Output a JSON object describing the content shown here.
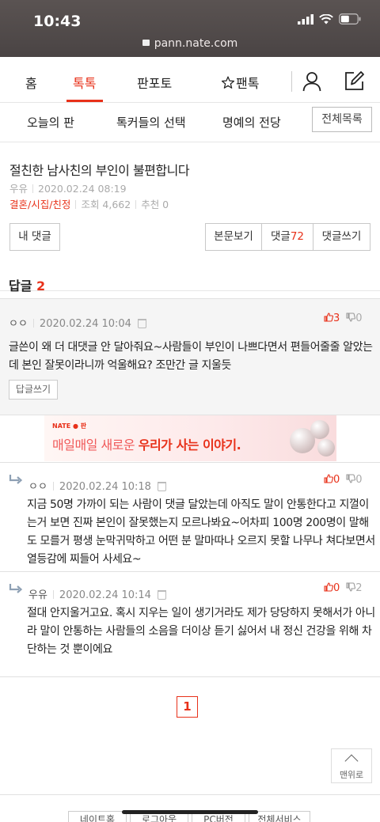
{
  "status_bar": {
    "time": "10:43"
  },
  "browser": {
    "url": "pann.nate.com"
  },
  "main_tabs": [
    {
      "label": "홈"
    },
    {
      "label": "톡톡"
    },
    {
      "label": "판포토"
    },
    {
      "label": "팬톡"
    }
  ],
  "sub_nav": {
    "items": [
      {
        "label": "오늘의 판"
      },
      {
        "label": "톡커들의 선택"
      },
      {
        "label": "명예의 전당"
      }
    ],
    "all_list": "전체목록"
  },
  "article": {
    "title": "절친한 남사친의 부인이 불편합니다",
    "author": "우유",
    "date": "2020.02.24 08:19",
    "category": "결혼/시집/친정",
    "views": "조회 4,662",
    "recommend": "추천 0"
  },
  "buttons": {
    "my_comments": "내 댓글",
    "view_article": "본문보기",
    "comments_label": "댓글",
    "comments_count": "72",
    "write_comment": "댓글쓰기"
  },
  "replies_header": {
    "label": "답글",
    "count": "2"
  },
  "comments": [
    {
      "name": "ㅇㅇ",
      "date": "2020.02.24 10:04",
      "up": "3",
      "down": "0",
      "text": "글쓴이 왜 더 대댓글 안 달아줘요~사람들이 부인이 나쁘다면서 편들어줄줄 알았는데 본인 잘못이라니까 억울해요? 조만간 글 지울듯",
      "reply_button": "답글쓰기"
    },
    {
      "name": "ㅇㅇ",
      "date": "2020.02.24 10:18",
      "up": "0",
      "down": "0",
      "text": "지금 50명 가까이 되는 사람이 댓글 달았는데 아직도 말이 안통한다고 지껄이는거 보면 진짜 본인이 잘못했는지 모르나봐요~어차피 100명 200명이 말해도 모를거 평생 눈막귀막하고 어떤 분 말마따나 오르지 못할 나무나 쳐다보면서 열등감에 찌들어 사세요~"
    },
    {
      "name": "우유",
      "date": "2020.02.24 10:14",
      "up": "0",
      "down": "2",
      "text": "절대 안지울거고요. 혹시 지우는 일이 생기거라도 제가 당당하지 못해서가 아니라 말이 안통하는 사람들의 소음을 더이상 듣기 싫어서 내 정신 건강을 위해 차단하는 것 뿐이에요"
    }
  ],
  "ad": {
    "logo": "NATE ● 판",
    "text_plain": "매일매일 새로운 ",
    "text_bold": "우리가 사는 이야기."
  },
  "pagination": {
    "current": "1"
  },
  "to_top": "맨위로",
  "footer": [
    "네이트홈",
    "로그아웃",
    "PC버전",
    "전체서비스"
  ],
  "colors": {
    "accent": "#e8311a",
    "text": "#222222",
    "meta": "#aaaaaa"
  }
}
